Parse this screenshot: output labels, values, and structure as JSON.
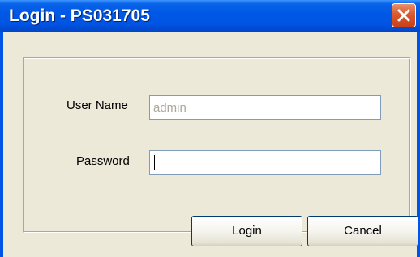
{
  "window": {
    "title": "Login - PS031705"
  },
  "form": {
    "username_label": "User Name",
    "username_value": "admin",
    "password_label": "Password",
    "password_value": ""
  },
  "buttons": {
    "login_label": "Login",
    "cancel_label": "Cancel"
  },
  "icons": {
    "close": "close-icon"
  },
  "colors": {
    "titlebar": "#0054e3",
    "close_button": "#d85a2e",
    "dialog_background": "#ece9d8",
    "field_border": "#7f9db9",
    "button_border": "#003c74"
  }
}
